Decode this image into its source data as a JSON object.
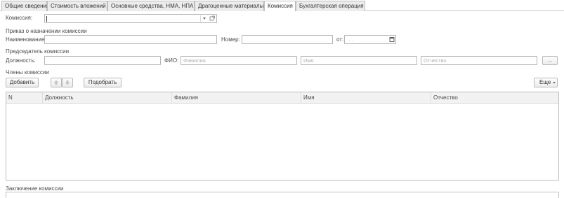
{
  "tabs": [
    {
      "label": "Общие сведения"
    },
    {
      "label": "Стоимость вложений"
    },
    {
      "label": "Основные средства, НМА, НПА"
    },
    {
      "label": "Драгоценные материалы"
    },
    {
      "label": "Комиссия"
    },
    {
      "label": "Бухгалтерская операция"
    }
  ],
  "active_tab": "Комиссия",
  "commission": {
    "label": "Комиссия:",
    "value": ""
  },
  "order": {
    "group_title": "Приказ о назначении комиссии",
    "name_label": "Наименование:",
    "number_label": "Номер:",
    "from_label": "от:",
    "date_value": ". ."
  },
  "chairman": {
    "group_title": "Председатель комиссии",
    "position_label": "Должность:",
    "fio_label": "ФИО:",
    "surname_placeholder": "Фамилия",
    "name_placeholder": "Имя",
    "patronymic_placeholder": "Отчество",
    "more_button": "..."
  },
  "members": {
    "group_title": "Члены комиссии",
    "add_button": "Добавить",
    "pick_button": "Подобрать",
    "more_button": "Еще",
    "columns": [
      "N",
      "Должность",
      "Фамилия",
      "Имя",
      "Отчество"
    ],
    "rows": []
  },
  "conclusion": {
    "label": "Заключение комиссии"
  }
}
